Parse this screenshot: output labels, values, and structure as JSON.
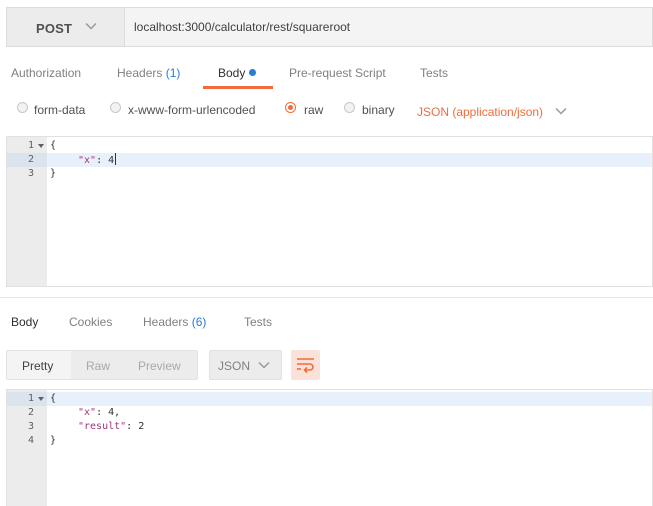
{
  "request": {
    "method": "POST",
    "url": "localhost:3000/calculator/rest/squareroot",
    "tabs": {
      "authorization": "Authorization",
      "headers": "Headers",
      "headers_count": "(1)",
      "body": "Body",
      "prerequest": "Pre-request Script",
      "tests": "Tests"
    },
    "body_types": {
      "form_data": "form-data",
      "urlencoded": "x-www-form-urlencoded",
      "raw": "raw",
      "binary": "binary",
      "selected": "raw"
    },
    "content_type": "JSON (application/json)",
    "editor": {
      "line_numbers": [
        "1",
        "2",
        "3"
      ],
      "line1": "{",
      "line2_key": "\"x\"",
      "line2_rest": ": 4",
      "line3": "}"
    }
  },
  "response": {
    "tabs": {
      "body": "Body",
      "cookies": "Cookies",
      "headers": "Headers",
      "headers_count": "(6)",
      "tests": "Tests"
    },
    "view_modes": {
      "pretty": "Pretty",
      "raw": "Raw",
      "preview": "Preview",
      "selected": "Pretty"
    },
    "format": "JSON",
    "editor": {
      "line_numbers": [
        "1",
        "2",
        "3",
        "4"
      ],
      "line1": "{",
      "line2_key": "\"x\"",
      "line2_rest": ": 4,",
      "line3_key": "\"result\"",
      "line3_rest": ": 2",
      "line4": "}"
    }
  },
  "colors": {
    "accent": "#f26b3a",
    "link_blue": "#2a7bd5",
    "json_key": "#a0367a"
  },
  "icons": {
    "method_dropdown": "chevron-down-icon",
    "content_type_dropdown": "chevron-down-icon",
    "format_dropdown": "chevron-down-icon",
    "wrap": "wrap-lines-icon",
    "fold": "fold-arrow-icon"
  }
}
